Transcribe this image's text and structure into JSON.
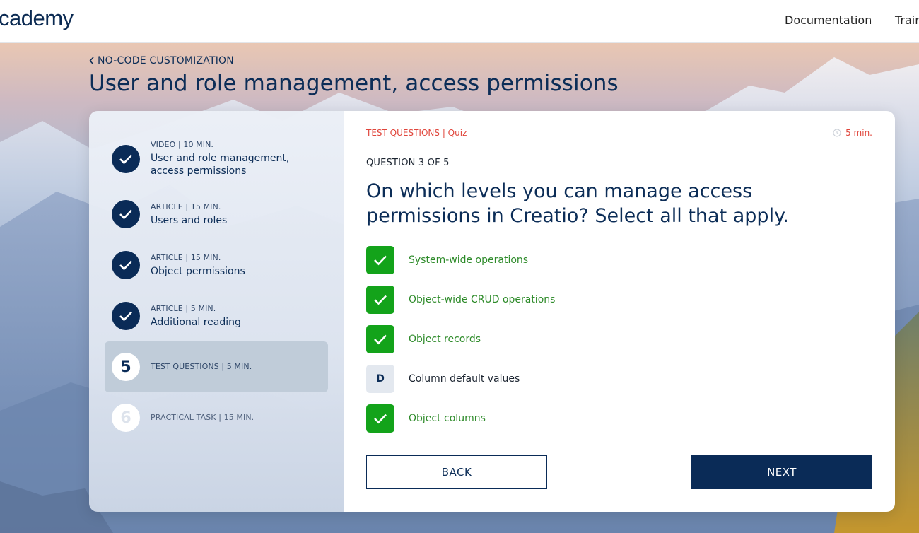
{
  "header": {
    "logo_text": "cademy",
    "nav": [
      "Documentation",
      "Trair"
    ]
  },
  "course": {
    "breadcrumb": "NO-CODE CUSTOMIZATION",
    "title": "User and role management, access permissions"
  },
  "steps": [
    {
      "meta": "VIDEO | 10 MIN.",
      "title": "User and role management, access permissions",
      "state": "done"
    },
    {
      "meta": "ARTICLE | 15 MIN.",
      "title": "Users and roles",
      "state": "done"
    },
    {
      "meta": "ARTICLE | 15 MIN.",
      "title": "Object permissions",
      "state": "done"
    },
    {
      "meta": "ARTICLE | 5 MIN.",
      "title": "Additional reading",
      "state": "done"
    },
    {
      "number": "5",
      "meta": "TEST QUESTIONS | 5 MIN.",
      "state": "active"
    },
    {
      "number": "6",
      "meta": "PRACTICAL TASK | 15 MIN.",
      "state": "locked"
    }
  ],
  "quiz": {
    "kicker": "TEST QUESTIONS | Quiz",
    "duration": "5 min.",
    "counter": "QUESTION 3 OF 5",
    "question": "On which levels you can manage access permissions in Creatio? Select all that apply.",
    "options": [
      {
        "label": "System-wide operations",
        "checked": true
      },
      {
        "label": "Object-wide CRUD operations",
        "checked": true
      },
      {
        "label": "Object records",
        "checked": true
      },
      {
        "label": "Column default values",
        "checked": false,
        "letter": "D"
      },
      {
        "label": "Object columns",
        "checked": true
      }
    ]
  },
  "buttons": {
    "back": "BACK",
    "next": "NEXT"
  },
  "colors": {
    "navy": "#0a2b57",
    "correct_green": "#13a31a",
    "accent_red": "#e0453b"
  }
}
